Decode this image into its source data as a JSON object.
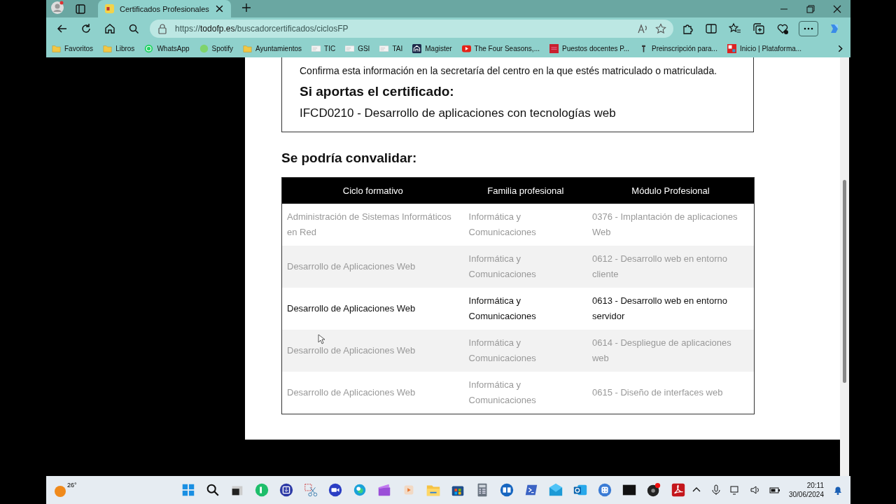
{
  "browser": {
    "tab": {
      "title": "Certificados Profesionales",
      "selected": true
    },
    "url": {
      "scheme": "https://",
      "host": "todofp.es",
      "path": "/buscadorcertificados/ciclosFP"
    },
    "bookmarks": [
      {
        "label": "Favoritos",
        "kind": "folder"
      },
      {
        "label": "Libros",
        "kind": "folder"
      },
      {
        "label": "WhatsApp",
        "kind": "whatsapp"
      },
      {
        "label": "Spotify",
        "kind": "spotify"
      },
      {
        "label": "Ayuntamientos",
        "kind": "folder"
      },
      {
        "label": "TIC",
        "kind": "page"
      },
      {
        "label": "GSI",
        "kind": "page"
      },
      {
        "label": "TAI",
        "kind": "page"
      },
      {
        "label": "Magister",
        "kind": "magister"
      },
      {
        "label": "The Four Seasons,...",
        "kind": "youtube"
      },
      {
        "label": "Puestos docentes P...",
        "kind": "red"
      },
      {
        "label": "Preinscripción para...",
        "kind": "tower"
      },
      {
        "label": "Inicio | Plataforma...",
        "kind": "plataforma"
      }
    ]
  },
  "notice": {
    "text": "Confirma esta información en la secretaría del centro en la que estés matriculado o matriculada.",
    "heading": "Si aportas el certificado:",
    "certificate": "IFCD0210 - Desarrollo de aplicaciones con tecnologías web"
  },
  "convalidation": {
    "title": "Se podría convalidar:",
    "columns": [
      "Ciclo formativo",
      "Familia profesional",
      "Módulo Profesional"
    ],
    "rows": [
      {
        "cells": [
          "Administración de Sistemas Informáticos en Red",
          "Informática y Comunicaciones",
          "0376 - Implantación de aplicaciones Web"
        ],
        "highlighted": false
      },
      {
        "cells": [
          "Desarrollo de Aplicaciones Web",
          "Informática y Comunicaciones",
          "0612 - Desarrollo web en entorno cliente"
        ],
        "highlighted": false
      },
      {
        "cells": [
          "Desarrollo de Aplicaciones Web",
          "Informática y Comunicaciones",
          "0613 - Desarrollo web en entorno servidor"
        ],
        "highlighted": true
      },
      {
        "cells": [
          "Desarrollo de Aplicaciones Web",
          "Informática y Comunicaciones",
          "0614 - Despliegue de aplicaciones web"
        ],
        "highlighted": false
      },
      {
        "cells": [
          "Desarrollo de Aplicaciones Web",
          "Informática y Comunicaciones",
          "0615 - Diseño de interfaces web"
        ],
        "highlighted": false
      }
    ]
  },
  "taskbar": {
    "weather": "26°",
    "time": "20:11",
    "date": "30/06/2024"
  }
}
